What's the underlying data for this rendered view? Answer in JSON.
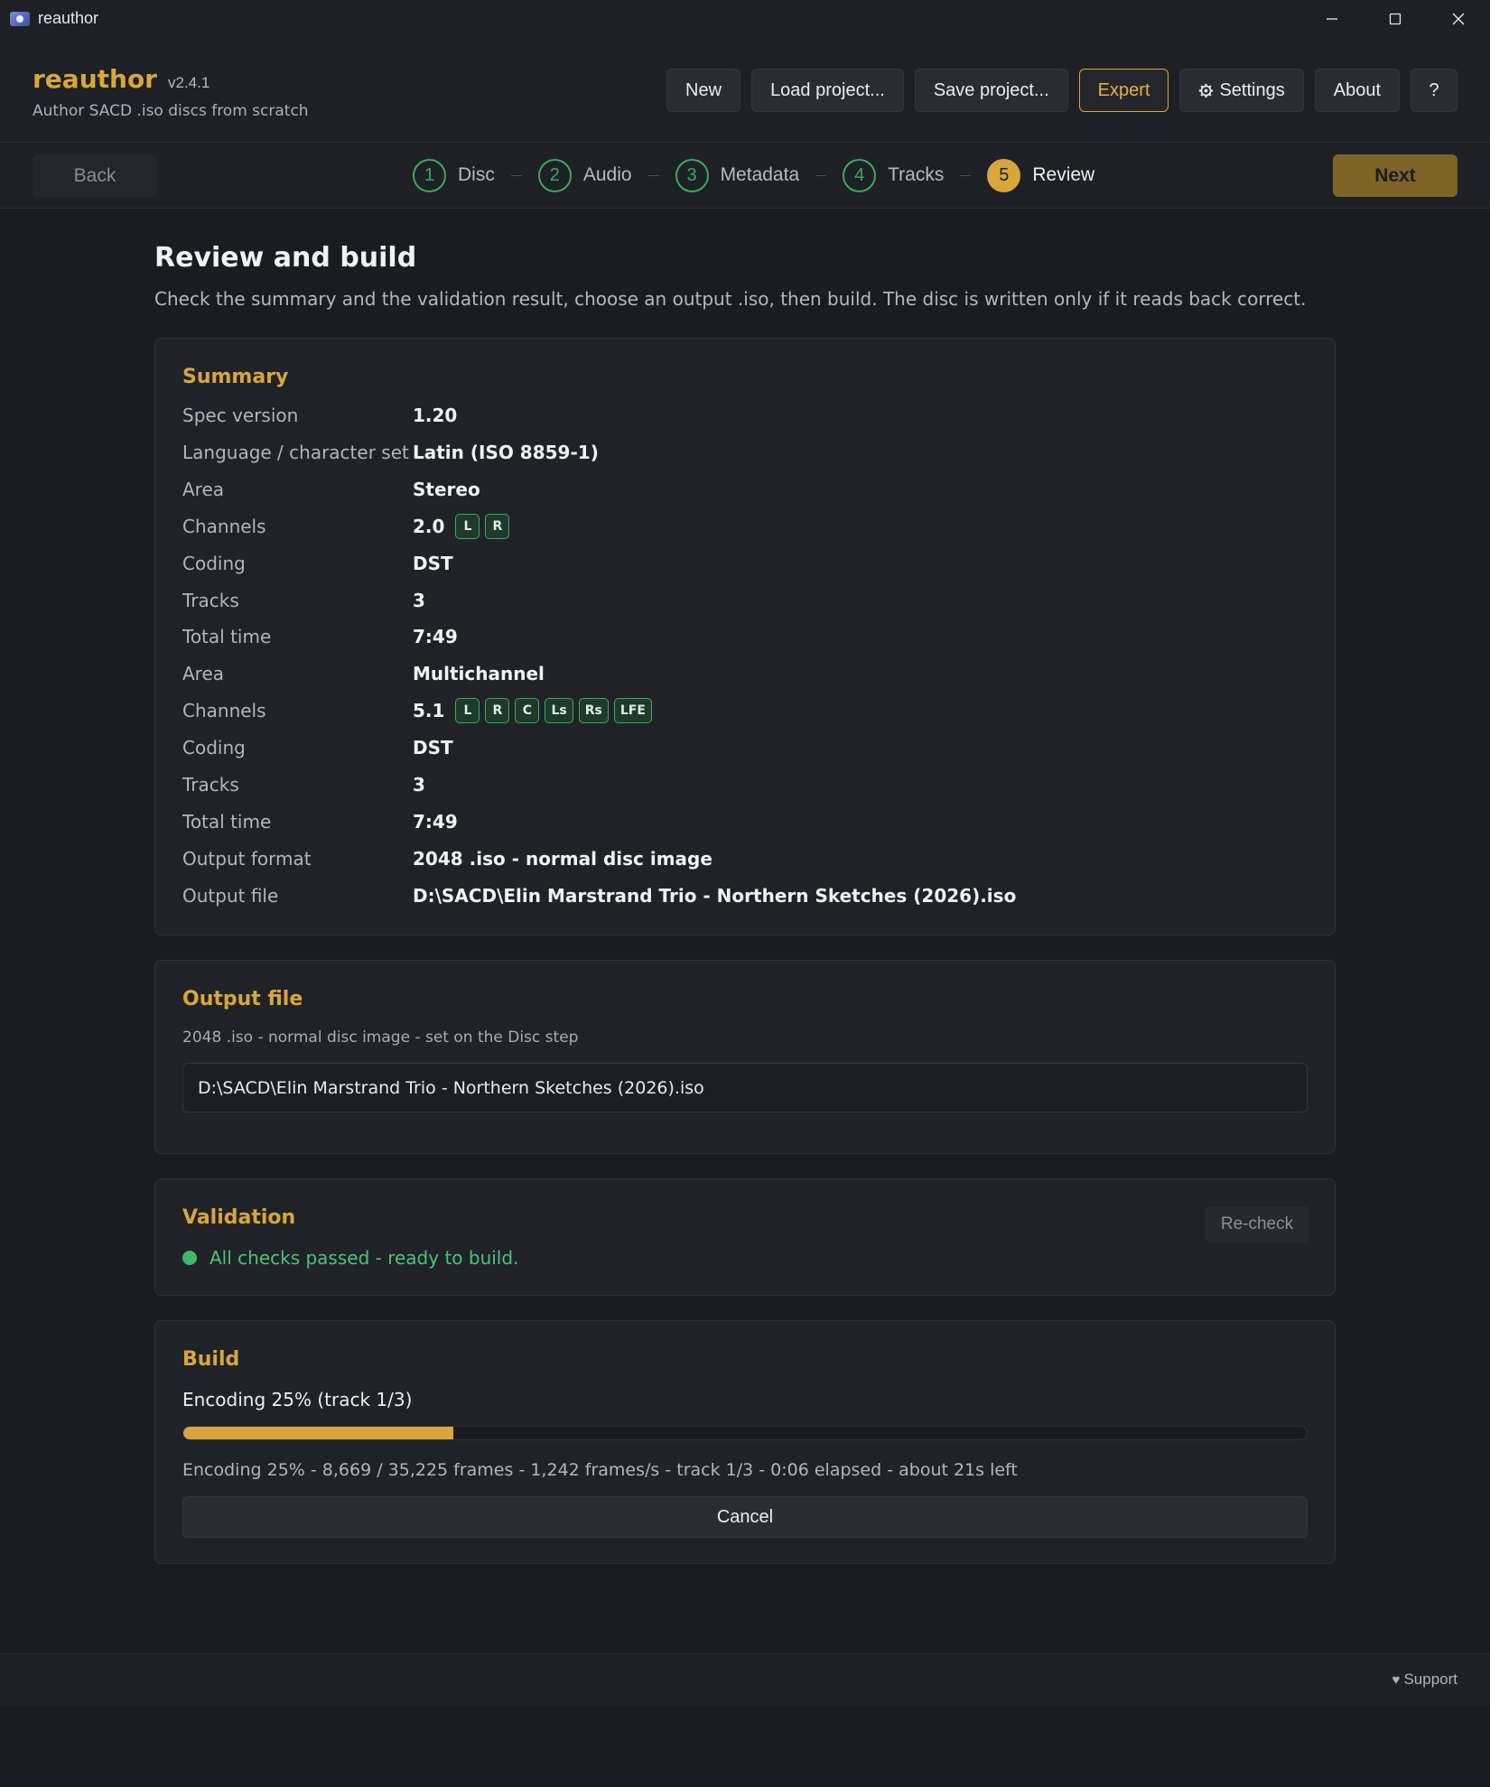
{
  "window": {
    "title": "reauthor",
    "icons": [
      "app-icon",
      "minimize-icon",
      "maximize-icon",
      "close-icon"
    ]
  },
  "header": {
    "brand": "reauthor",
    "version": "v2.4.1",
    "tagline": "Author SACD .iso discs from scratch",
    "buttons": {
      "new": "New",
      "load": "Load project...",
      "save": "Save project...",
      "expert": "Expert",
      "settings": "Settings",
      "about": "About",
      "help": "?"
    }
  },
  "steps": {
    "back": "Back",
    "next": "Next",
    "items": [
      {
        "num": "1",
        "label": "Disc"
      },
      {
        "num": "2",
        "label": "Audio"
      },
      {
        "num": "3",
        "label": "Metadata"
      },
      {
        "num": "4",
        "label": "Tracks"
      },
      {
        "num": "5",
        "label": "Review"
      }
    ]
  },
  "page": {
    "title": "Review and build",
    "subtitle": "Check the summary and the validation result, choose an output .iso, then build. The disc is written only if it reads back correct."
  },
  "summary": {
    "title": "Summary",
    "rows": [
      {
        "key": "Spec version",
        "value": "1.20"
      },
      {
        "key": "Language / character set",
        "value": "Latin (ISO 8859-1)"
      },
      {
        "key": "Area",
        "value": "Stereo"
      },
      {
        "key": "Channels",
        "value": "2.0",
        "chips": [
          "L",
          "R"
        ]
      },
      {
        "key": "Coding",
        "value": "DST"
      },
      {
        "key": "Tracks",
        "value": "3"
      },
      {
        "key": "Total time",
        "value": "7:49"
      },
      {
        "key": "Area",
        "value": "Multichannel"
      },
      {
        "key": "Channels",
        "value": "5.1",
        "chips": [
          "L",
          "R",
          "C",
          "Ls",
          "Rs",
          "LFE"
        ]
      },
      {
        "key": "Coding",
        "value": "DST"
      },
      {
        "key": "Tracks",
        "value": "3"
      },
      {
        "key": "Total time",
        "value": "7:49"
      },
      {
        "key": "Output format",
        "value": "2048 .iso - normal disc image"
      },
      {
        "key": "Output file",
        "value": "D:\\SACD\\Elin Marstrand Trio - Northern Sketches (2026).iso"
      }
    ]
  },
  "output": {
    "title": "Output file",
    "subtitle": "2048 .iso - normal disc image - set on the Disc step",
    "path": "D:\\SACD\\Elin Marstrand Trio - Northern Sketches (2026).iso"
  },
  "validation": {
    "title": "Validation",
    "recheck": "Re-check",
    "status": "All checks passed - ready to build.",
    "status_color": "#3fb76a"
  },
  "build": {
    "title": "Build",
    "status": "Encoding 25% (track 1/3)",
    "progress_percent": 24,
    "detail": "Encoding 25% - 8,669 / 35,225 frames - 1,242 frames/s - track 1/3 - 0:06 elapsed - about 21s left",
    "cancel": "Cancel"
  },
  "footer": {
    "support": "Support"
  },
  "colors": {
    "accent": "#d8a63d",
    "success": "#3aa866",
    "background": "#1b1c21"
  }
}
